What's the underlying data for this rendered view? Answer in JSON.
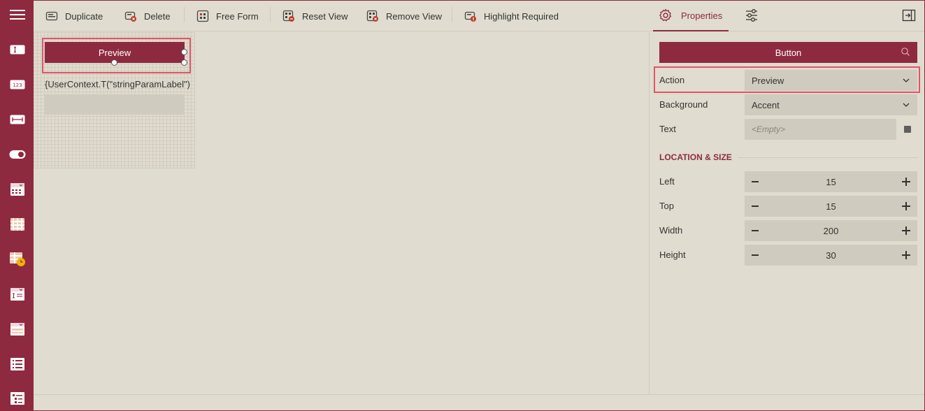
{
  "toolbar": {
    "duplicate": "Duplicate",
    "delete": "Delete",
    "free_form": "Free Form",
    "reset_view": "Reset View",
    "remove_view": "Remove View",
    "highlight_required": "Highlight Required",
    "properties_tab": "Properties"
  },
  "sidebar": {
    "icons": [
      "menu-icon",
      "text-field-icon",
      "numeric-field-icon",
      "range-field-icon",
      "toggle-icon",
      "date-picker-icon",
      "date-range-icon",
      "date-time-icon",
      "dropdown-input-icon",
      "dropdown-icon",
      "list-icon",
      "tree-list-icon"
    ],
    "numeric_glyph": "123"
  },
  "canvas": {
    "button_label": "Preview",
    "label_text": "{UserContext.T(\"stringParamLabel\")"
  },
  "panel": {
    "component": "Button",
    "action_label": "Action",
    "action_value": "Preview",
    "background_label": "Background",
    "background_value": "Accent",
    "text_label": "Text",
    "text_placeholder": "<Empty>",
    "section_title": "LOCATION & SIZE",
    "left_label": "Left",
    "left_value": "15",
    "top_label": "Top",
    "top_value": "15",
    "width_label": "Width",
    "width_value": "200",
    "height_label": "Height",
    "height_value": "30"
  },
  "colors": {
    "accent": "#8e2a3f",
    "highlight": "#e0556a",
    "background": "#e0dccf"
  }
}
